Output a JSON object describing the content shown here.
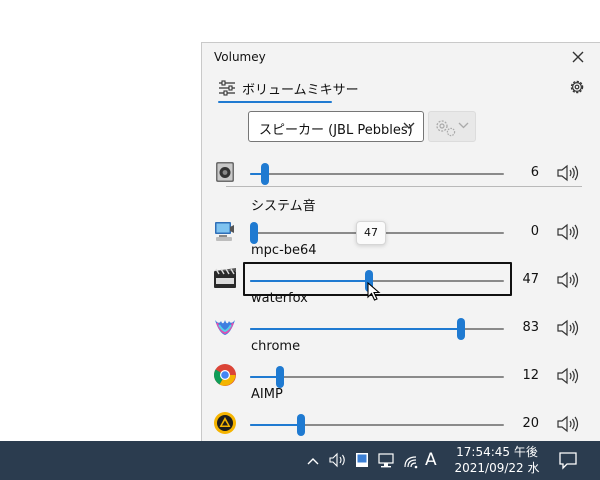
{
  "window": {
    "title": "Volumey"
  },
  "tabs": [
    {
      "label": "ボリュームミキサー"
    }
  ],
  "device": {
    "selected": "スピーカー (JBL Pebbles)",
    "volume": 6
  },
  "sessions": [
    {
      "name": "システム音",
      "volume": 0,
      "icon": "system-sounds-icon"
    },
    {
      "name": "mpc-be64",
      "volume": 47,
      "icon": "mpc-be-icon"
    },
    {
      "name": "waterfox",
      "volume": 83,
      "icon": "waterfox-icon"
    },
    {
      "name": "chrome",
      "volume": 12,
      "icon": "chrome-icon"
    },
    {
      "name": "AIMP",
      "volume": 20,
      "icon": "aimp-icon"
    }
  ],
  "tooltip": {
    "value": "47"
  },
  "taskbar": {
    "ime_label": "A",
    "time": "17:54:45 午後",
    "date": "2021/09/22 水"
  },
  "colors": {
    "accent": "#1f7ad1",
    "taskbar": "#2b3c4f"
  }
}
